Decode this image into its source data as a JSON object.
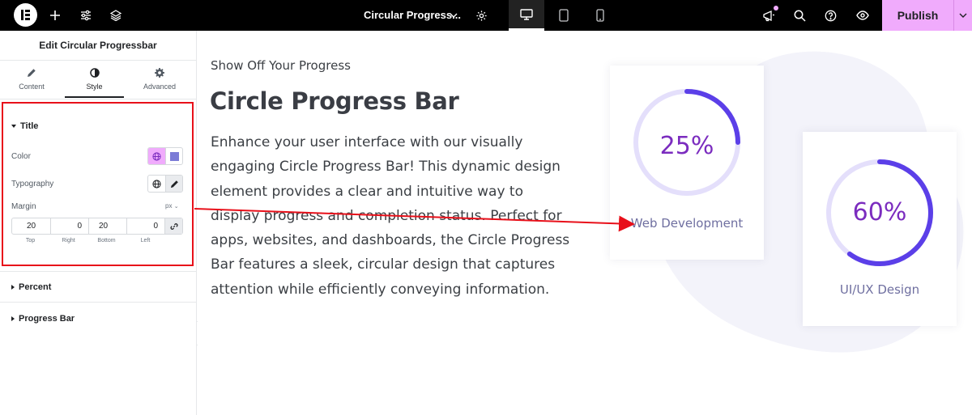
{
  "topbar": {
    "document_title": "Circular Progress...",
    "publish_label": "Publish"
  },
  "panel": {
    "title": "Edit Circular Progressbar",
    "tabs": [
      {
        "label": "Content",
        "icon": "pencil-icon"
      },
      {
        "label": "Style",
        "icon": "half-circle-icon",
        "active": true
      },
      {
        "label": "Advanced",
        "icon": "gear-icon"
      }
    ],
    "sections": {
      "title": "Title",
      "percent": "Percent",
      "progress_bar": "Progress Bar"
    },
    "controls": {
      "color_label": "Color",
      "typography_label": "Typography",
      "margin_label": "Margin",
      "margin_unit": "px",
      "margin": {
        "top": "20",
        "right": "0",
        "bottom": "20",
        "left": "0"
      },
      "margin_labels": {
        "top": "Top",
        "right": "Right",
        "bottom": "Bottom",
        "left": "Left"
      },
      "color_swatch": "#7b7bd6"
    }
  },
  "canvas": {
    "kicker": "Show Off Your Progress",
    "heading": "Circle Progress Bar",
    "body": "Enhance your user interface with our visually engaging Circle Progress Bar! This dynamic design element provides a clear and intuitive way to display progress and completion status. Perfect for apps, websites, and dashboards, the Circle Progress Bar features a sleek, circular design that captures attention while efficiently conveying information.",
    "cards": [
      {
        "percent_label": "25%",
        "progress": 0.25,
        "label": "Web Development"
      },
      {
        "percent_label": "60%",
        "progress": 0.6,
        "label": "UI/UX Design"
      }
    ]
  },
  "colors": {
    "accent_ring": "#5b3fe8",
    "ring_track": "#e4dffb",
    "percent_text": "#7b2cbf",
    "publish_bg": "#f0abfc",
    "annotation_red": "#e8101a",
    "blob": "#f3f3fa"
  }
}
